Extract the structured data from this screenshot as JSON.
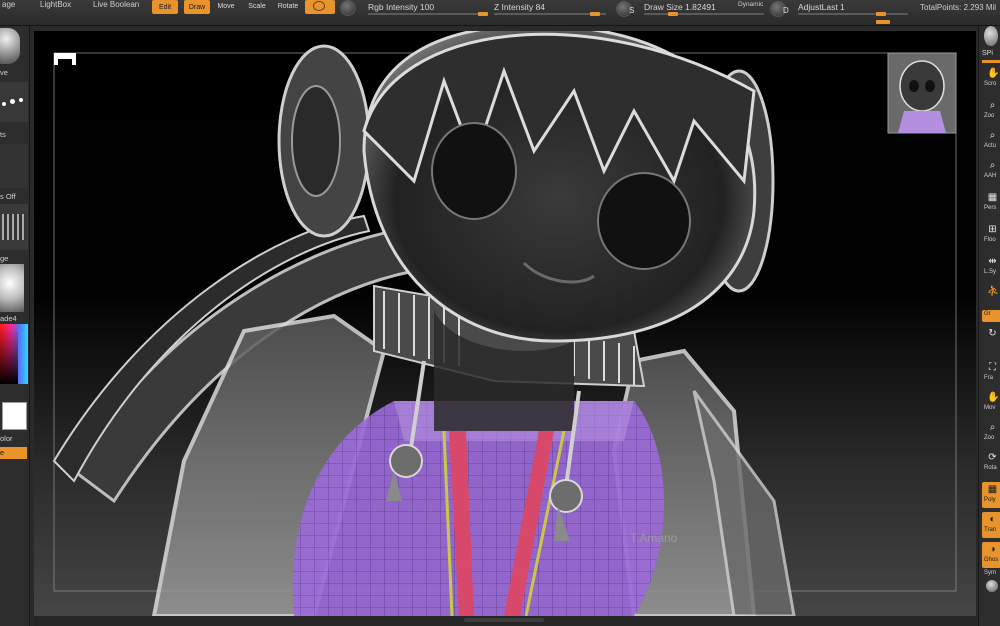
{
  "topbar": {
    "frag_left": "age",
    "lightbox": "LightBox",
    "live_boolean": "Live Boolean",
    "edit": "Edit",
    "draw": "Draw",
    "move": "Move",
    "scale": "Scale",
    "rotate": "Rotate",
    "rgb_intensity_label": "Rgb Intensity 100",
    "rgb_intensity_value": 100,
    "z_intensity_label": "Z Intensity 84",
    "z_intensity_value": 84,
    "s_key": "S",
    "draw_size_label": "Draw Size 1.82491",
    "dynamic": "Dynamic",
    "d_key": "D",
    "adjust_last_label": "AdjustLast 1",
    "total_points": "TotalPoints: 2.293 Mil"
  },
  "lefttray": {
    "lbl_ve": "ve",
    "lbl_ts": "ts",
    "lbl_off": "s Off",
    "lbl_ge": "ge",
    "lbl_shade": "ade4",
    "lbl_color": "olor",
    "lbl_e": "e"
  },
  "righttray": {
    "spi": "SPi",
    "items": [
      {
        "label": "Scro"
      },
      {
        "label": "Zoo"
      },
      {
        "label": "Actu"
      },
      {
        "label": "AAH"
      },
      {
        "label": "Pers"
      },
      {
        "label": "Floo"
      },
      {
        "label": "L.Sy"
      },
      {
        "label": ""
      },
      {
        "label": "Gr"
      },
      {
        "label": "Fra"
      },
      {
        "label": "Mov"
      },
      {
        "label": "Zoo"
      },
      {
        "label": "Rota"
      },
      {
        "label": "Poly"
      },
      {
        "label": "Tran"
      },
      {
        "label": "Ghos"
      },
      {
        "label": "Sym"
      }
    ]
  },
  "canvas": {
    "watermark": "T.Amano"
  },
  "colors": {
    "accent": "#e8932b",
    "mesh_purple": "#9a6ad8",
    "zipper_red": "#d8486a",
    "zipper_yellow": "#c8c848"
  }
}
